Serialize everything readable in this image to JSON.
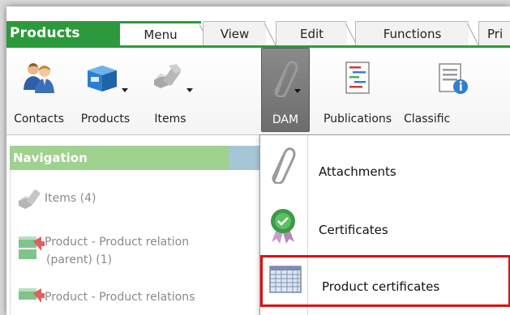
{
  "app": {
    "title": "Products",
    "accent_color": "#2c9a3c"
  },
  "tabs": [
    {
      "label": "Menu",
      "active": true
    },
    {
      "label": "View",
      "active": false
    },
    {
      "label": "Edit",
      "active": false
    },
    {
      "label": "Functions",
      "active": false
    },
    {
      "label": "Pri",
      "active": false
    }
  ],
  "ribbon": {
    "buttons": [
      {
        "label": "Contacts",
        "icon": "contacts-icon",
        "has_dropdown": false
      },
      {
        "label": "Products",
        "icon": "products-box-icon",
        "has_dropdown": true
      },
      {
        "label": "Items",
        "icon": "items-bolts-icon",
        "has_dropdown": true
      },
      {
        "label": "DAM",
        "icon": "paperclip-icon",
        "has_dropdown": true,
        "pressed": true
      },
      {
        "label": "Publications",
        "icon": "publications-icon",
        "has_dropdown": false
      },
      {
        "label": "Classific",
        "icon": "classification-icon",
        "has_dropdown": false
      }
    ]
  },
  "navigation": {
    "title": "Navigation",
    "items": [
      {
        "label": "Items (4)",
        "icon": "items-bolts-icon"
      },
      {
        "label_line1": "Product - Product relation",
        "label_line2": "(parent) (1)",
        "icon": "product-relation-icon"
      },
      {
        "label_line1": "Product - Product relations",
        "icon": "product-relation-icon"
      }
    ]
  },
  "dam_menu": {
    "items": [
      {
        "label": "Attachments",
        "icon": "paperclip-icon"
      },
      {
        "label": "Certificates",
        "icon": "certificate-seal-icon"
      },
      {
        "label": "Product certificates",
        "icon": "grid-table-icon",
        "highlighted": true
      }
    ]
  }
}
